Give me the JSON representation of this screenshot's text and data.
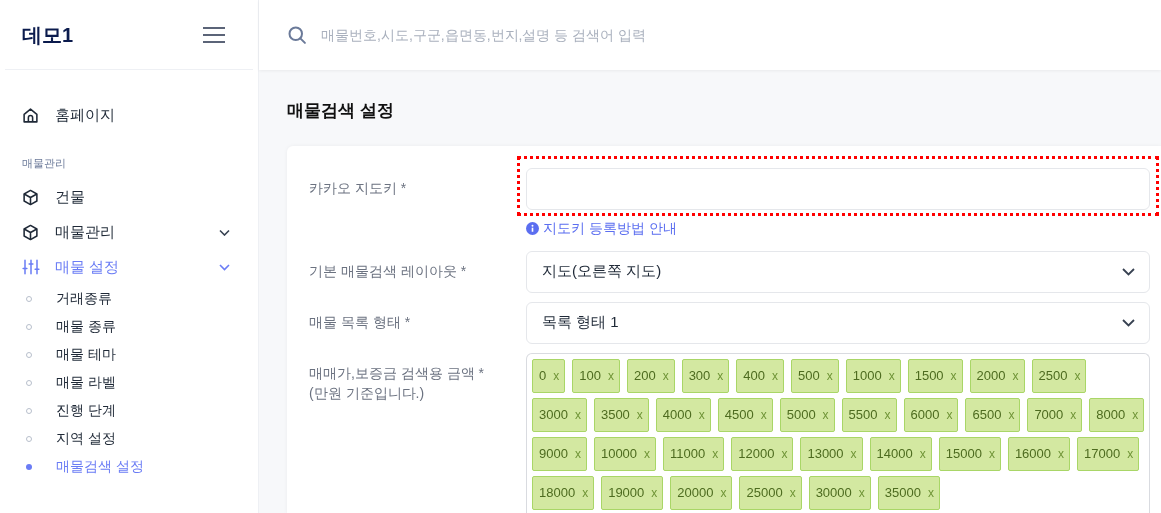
{
  "sidebar": {
    "logo": "데모1",
    "items": [
      {
        "kind": "link",
        "label": "홈페이지",
        "selected": false
      },
      {
        "kind": "section",
        "label": "매물관리"
      },
      {
        "kind": "link",
        "label": "건물",
        "selected": false
      },
      {
        "kind": "group",
        "label": "매물관리",
        "selected": false,
        "expanded": false
      },
      {
        "kind": "group",
        "label": "매물 설정",
        "selected": true,
        "expanded": true,
        "children": [
          {
            "label": "거래종류",
            "selected": false
          },
          {
            "label": "매물 종류",
            "selected": false
          },
          {
            "label": "매물 테마",
            "selected": false
          },
          {
            "label": "매물 라벨",
            "selected": false
          },
          {
            "label": "진행 단계",
            "selected": false
          },
          {
            "label": "지역 설정",
            "selected": false
          },
          {
            "label": "매물검색 설정",
            "selected": true
          }
        ]
      }
    ]
  },
  "search": {
    "placeholder": "매물번호,시도,구군,읍면동,번지,설명 등 검색어 입력"
  },
  "page_title": "매물검색 설정",
  "form": [
    {
      "kind": "text",
      "label": "카카오 지도키 *",
      "highlighted": true,
      "help": "지도키 등록방법 안내"
    },
    {
      "kind": "select",
      "label": "기본 매물검색 레이아웃 *",
      "value": "지도(오른쪽 지도)"
    },
    {
      "kind": "select",
      "label": "매물 목록 형태 *",
      "value": "목록 형태 1"
    },
    {
      "kind": "tags",
      "label": "매매가,보증금 검색용 금액 *",
      "note": "(만원 기준입니다.)",
      "tags": [
        {
          "label": "0",
          "remove": "x"
        },
        {
          "label": "100",
          "remove": "x"
        },
        {
          "label": "200",
          "remove": "x"
        },
        {
          "label": "300",
          "remove": "x"
        },
        {
          "label": "400",
          "remove": "x"
        },
        {
          "label": "500",
          "remove": "x"
        },
        {
          "label": "1000",
          "remove": "x"
        },
        {
          "label": "1500",
          "remove": "x"
        },
        {
          "label": "2000",
          "remove": "x"
        },
        {
          "label": "2500",
          "remove": "x"
        },
        {
          "label": "3000",
          "remove": "x"
        },
        {
          "label": "3500",
          "remove": "x"
        },
        {
          "label": "4000",
          "remove": "x"
        },
        {
          "label": "4500",
          "remove": "x"
        },
        {
          "label": "5000",
          "remove": "x"
        },
        {
          "label": "5500",
          "remove": "x"
        },
        {
          "label": "6000",
          "remove": "x"
        },
        {
          "label": "6500",
          "remove": "x"
        },
        {
          "label": "7000",
          "remove": "x"
        },
        {
          "label": "8000",
          "remove": "x"
        },
        {
          "label": "9000",
          "remove": "x"
        },
        {
          "label": "10000",
          "remove": "x"
        },
        {
          "label": "11000",
          "remove": "x"
        },
        {
          "label": "12000",
          "remove": "x"
        },
        {
          "label": "13000",
          "remove": "x"
        },
        {
          "label": "14000",
          "remove": "x"
        },
        {
          "label": "15000",
          "remove": "x"
        },
        {
          "label": "16000",
          "remove": "x"
        },
        {
          "label": "17000",
          "remove": "x"
        },
        {
          "label": "18000",
          "remove": "x"
        },
        {
          "label": "19000",
          "remove": "x"
        },
        {
          "label": "20000",
          "remove": "x"
        },
        {
          "label": "25000",
          "remove": "x"
        },
        {
          "label": "30000",
          "remove": "x"
        },
        {
          "label": "35000",
          "remove": "x"
        }
      ]
    }
  ]
}
